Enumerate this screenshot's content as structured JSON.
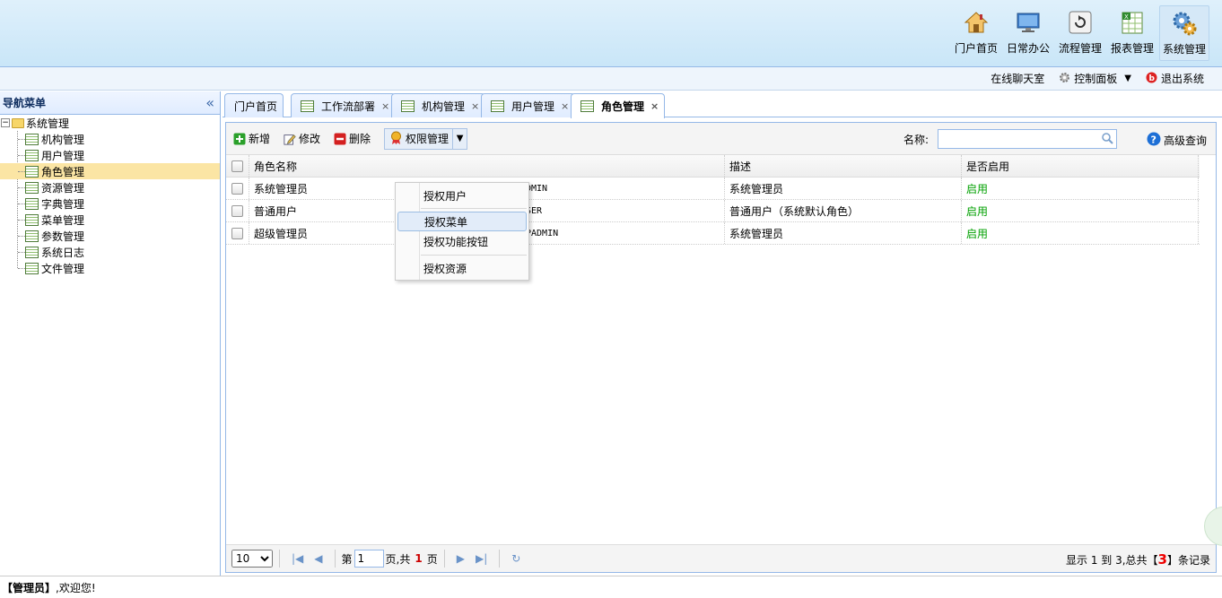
{
  "header": {
    "nav": [
      {
        "label": "门户首页",
        "icon": "home-icon"
      },
      {
        "label": "日常办公",
        "icon": "monitor-icon"
      },
      {
        "label": "流程管理",
        "icon": "refresh-icon"
      },
      {
        "label": "报表管理",
        "icon": "spreadsheet-icon"
      },
      {
        "label": "系统管理",
        "icon": "gears-icon"
      }
    ]
  },
  "subbar": {
    "chat": "在线聊天室",
    "control_panel": "控制面板",
    "logout": "退出系统"
  },
  "sidebar": {
    "title": "导航菜单",
    "collapse_glyph": "«",
    "root": "系统管理",
    "items": [
      "机构管理",
      "用户管理",
      "角色管理",
      "资源管理",
      "字典管理",
      "菜单管理",
      "参数管理",
      "系统日志",
      "文件管理"
    ],
    "selected": "角色管理"
  },
  "tabs": [
    {
      "label": "门户首页",
      "closable": false
    },
    {
      "label": "工作流部署",
      "closable": true
    },
    {
      "label": "机构管理",
      "closable": true
    },
    {
      "label": "用户管理",
      "closable": true
    },
    {
      "label": "角色管理",
      "closable": true,
      "active": true
    }
  ],
  "toolbar": {
    "add": "新增",
    "edit": "修改",
    "delete": "删除",
    "permission": "权限管理",
    "search_label": "名称:",
    "search_value": "",
    "advanced": "高级查询"
  },
  "menu": {
    "items": [
      "授权用户",
      "授权菜单",
      "授权功能按钮",
      "授权资源"
    ],
    "hovered": "授权菜单"
  },
  "grid": {
    "headers": [
      "角色名称",
      "",
      "描述",
      "是否启用"
    ],
    "rows": [
      {
        "name": "系统管理员",
        "code": "DMIN",
        "desc": "系统管理员",
        "enabled": "启用"
      },
      {
        "name": "普通用户",
        "code": "SER",
        "desc": "普通用户（系统默认角色）",
        "enabled": "启用"
      },
      {
        "name": "超级管理员",
        "code": "PADMIN",
        "desc": "系统管理员",
        "enabled": "启用"
      }
    ]
  },
  "pager": {
    "page_size": "10",
    "page_prefix": "第",
    "page_value": "1",
    "page_mid": "页,共",
    "page_total": "1",
    "page_suffix": "页",
    "info_prefix": "显示 1 到 3,总共【",
    "info_total": "3",
    "info_suffix": "】条记录"
  },
  "footer": {
    "user": "【管理员】",
    "welcome": ",欢迎您!"
  }
}
